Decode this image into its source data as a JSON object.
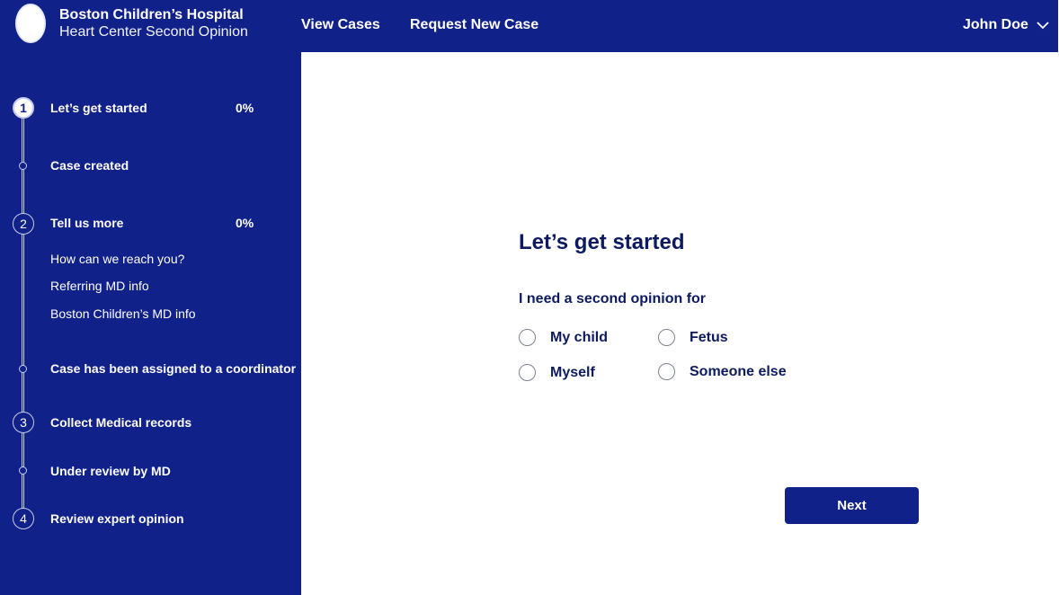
{
  "header": {
    "brand_title": "Boston Children’s Hospital",
    "brand_subtitle": "Heart Center Second Opinion",
    "nav": [
      "View Cases",
      "Request New Case"
    ],
    "user_name": "John Doe",
    "background_color": "#11218a"
  },
  "sidebar": {
    "steps": [
      {
        "number": "1",
        "label": "Let’s get started",
        "percent": "0%"
      },
      {
        "label": "Case created"
      },
      {
        "number": "2",
        "label": "Tell us more",
        "percent": "0%"
      },
      {
        "label": "How can we reach you?"
      },
      {
        "label": "Referring MD info"
      },
      {
        "label": "Boston Children’s MD info"
      },
      {
        "label": "Case has been assigned to a coordinator"
      },
      {
        "number": "3",
        "label": "Collect Medical records"
      },
      {
        "label": "Under review by MD"
      },
      {
        "number": "4",
        "label": "Review expert opinion"
      }
    ]
  },
  "main": {
    "title": "Let’s get started",
    "question": "I need a second opinion for",
    "options": [
      "My child",
      "Fetus",
      "Myself",
      "Someone else"
    ],
    "next_label": "Next"
  }
}
